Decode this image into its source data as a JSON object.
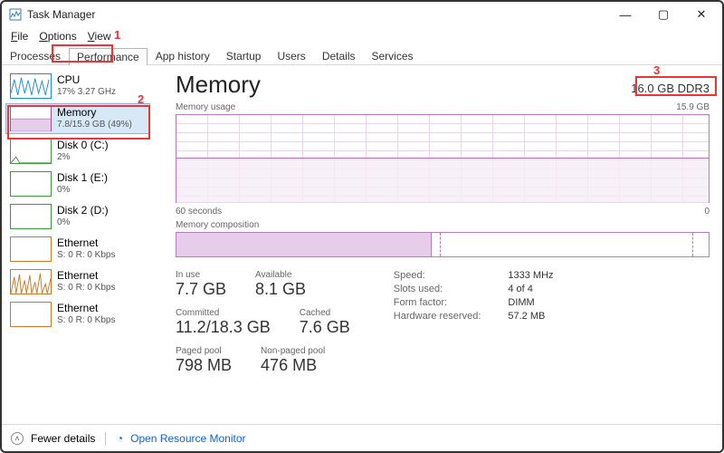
{
  "window": {
    "title": "Task Manager"
  },
  "menubar": {
    "file": "File",
    "options": "Options",
    "view": "View"
  },
  "tabs": {
    "processes": "Processes",
    "performance": "Performance",
    "app_history": "App history",
    "startup": "Startup",
    "users": "Users",
    "details": "Details",
    "services": "Services"
  },
  "sidebar": [
    {
      "title": "CPU",
      "sub": "17%  3.27 GHz",
      "color": "#1e90d2"
    },
    {
      "title": "Memory",
      "sub": "7.8/15.9 GB (49%)",
      "color": "#9a4fab"
    },
    {
      "title": "Disk 0 (C:)",
      "sub": "2%",
      "color": "#3d9a3d"
    },
    {
      "title": "Disk 1 (E:)",
      "sub": "0%",
      "color": "#3d9a3d"
    },
    {
      "title": "Disk 2 (D:)",
      "sub": "0%",
      "color": "#3d9a3d"
    },
    {
      "title": "Ethernet",
      "sub": "S: 0  R: 0 Kbps",
      "color": "#c97a2a"
    },
    {
      "title": "Ethernet",
      "sub": "S: 0  R: 0 Kbps",
      "color": "#c97a2a"
    },
    {
      "title": "Ethernet",
      "sub": "S: 0  R: 0 Kbps",
      "color": "#c97a2a"
    }
  ],
  "main": {
    "heading": "Memory",
    "memory_spec": "16.0 GB DDR3",
    "chart1_label_left": "Memory usage",
    "chart1_label_right": "15.9 GB",
    "chart1_bottom_left": "60 seconds",
    "chart1_bottom_right": "0",
    "chart2_label": "Memory composition",
    "stats": {
      "in_use_l": "In use",
      "in_use_v": "7.7 GB",
      "avail_l": "Available",
      "avail_v": "8.1 GB",
      "committed_l": "Committed",
      "committed_v": "11.2/18.3 GB",
      "cached_l": "Cached",
      "cached_v": "7.6 GB",
      "paged_l": "Paged pool",
      "paged_v": "798 MB",
      "nonpaged_l": "Non-paged pool",
      "nonpaged_v": "476 MB"
    },
    "sys": {
      "speed_k": "Speed:",
      "speed_v": "1333 MHz",
      "slots_k": "Slots used:",
      "slots_v": "4 of 4",
      "form_k": "Form factor:",
      "form_v": "DIMM",
      "hw_k": "Hardware reserved:",
      "hw_v": "57.2 MB"
    }
  },
  "footer": {
    "fewer": "Fewer details",
    "orm": "Open Resource Monitor"
  },
  "annotations": {
    "one": "1",
    "two": "2",
    "three": "3"
  },
  "chart_data": {
    "type": "area",
    "title": "Memory usage",
    "x_left": "60 seconds",
    "x_right": "0",
    "ylim": [
      0,
      15.9
    ],
    "ylabel": "GB",
    "approx_value_gb": 7.8,
    "composition": {
      "in_use_pct": 48,
      "modified_pct": 1.5,
      "standby_pct": 48,
      "free_pct": 2.5
    }
  }
}
